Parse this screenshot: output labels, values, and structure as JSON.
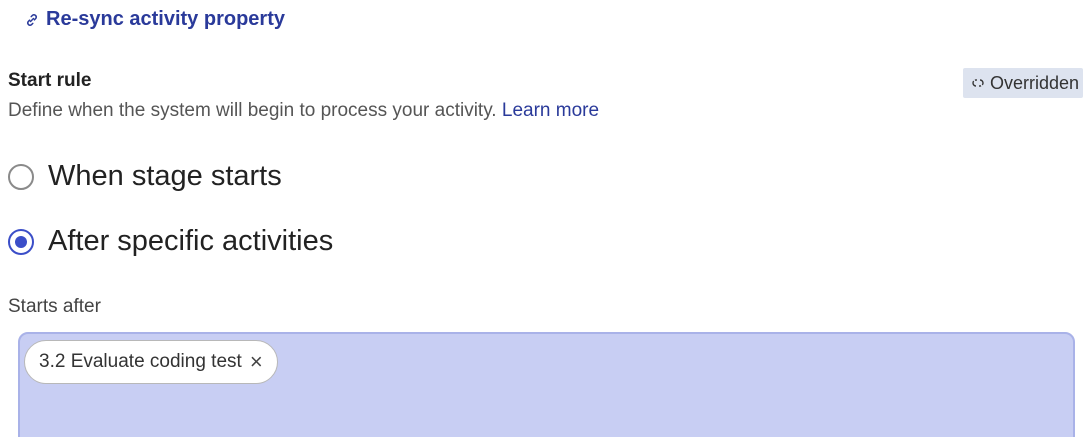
{
  "resync": {
    "icon": "link-icon",
    "label": "Re-sync activity property"
  },
  "start_rule": {
    "title": "Start rule",
    "description": "Define when the system will begin to process your activity.",
    "learn_more": "Learn more",
    "overridden": {
      "icon": "broken-link-icon",
      "label": "Overridden"
    }
  },
  "options": [
    {
      "label": "When stage starts",
      "selected": false
    },
    {
      "label": "After specific activities",
      "selected": true
    }
  ],
  "starts_after": {
    "label": "Starts after",
    "chips": [
      {
        "label": "3.2 Evaluate coding test",
        "remove": "×"
      }
    ]
  },
  "colors": {
    "accent": "#3b4ec8",
    "link": "#2a3a9a",
    "input_bg": "#c8cef3",
    "badge_bg": "#dde3ef"
  }
}
